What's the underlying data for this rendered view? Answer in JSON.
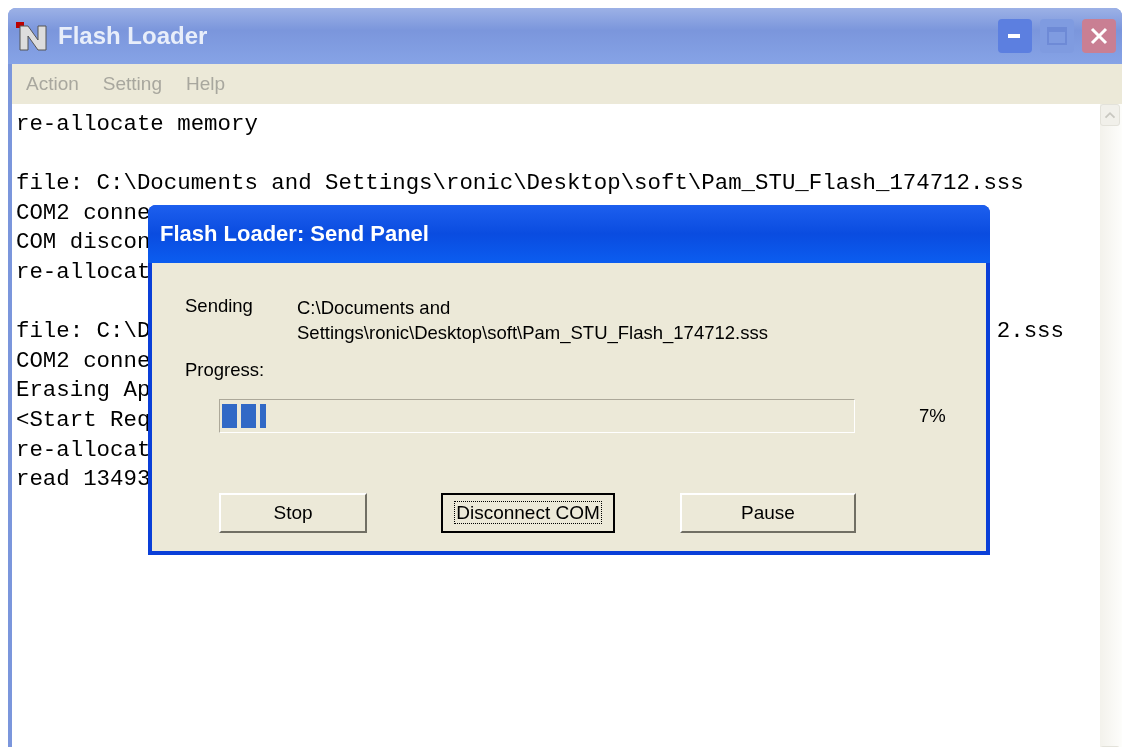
{
  "window": {
    "title": "Flash Loader"
  },
  "menu": [
    "Action",
    "Setting",
    "Help"
  ],
  "log_blocks": [
    [
      {
        "text": "re-allocate memory"
      }
    ],
    [
      {
        "text": "file: C:\\Documents and Settings\\ronic\\Desktop\\soft\\Pam_STU_Flash_174712.sss"
      },
      {
        "text": "COM2 conne"
      },
      {
        "text": "COM discon"
      },
      {
        "text": "re-allocat"
      }
    ],
    [
      {
        "text": "file: C:\\D",
        "tail": "2.sss"
      },
      {
        "text": "COM2 conne"
      },
      {
        "text": "Erasing Ap"
      },
      {
        "text": "<Start Req"
      },
      {
        "text": "re-allocat"
      },
      {
        "text": "read 13493"
      }
    ]
  ],
  "dialog": {
    "title": "Flash Loader: Send Panel",
    "sending_label": "Sending",
    "sending_path": "C:\\Documents and Settings\\ronic\\Desktop\\soft\\Pam_STU_Flash_174712.sss",
    "progress_label": "Progress:",
    "progress": {
      "level": 0.07,
      "reading": "7%"
    },
    "buttons": [
      {
        "label": "Stop",
        "focused": false
      },
      {
        "label": "Disconnect COM",
        "focused": true
      },
      {
        "label": "Pause",
        "focused": false
      }
    ]
  }
}
